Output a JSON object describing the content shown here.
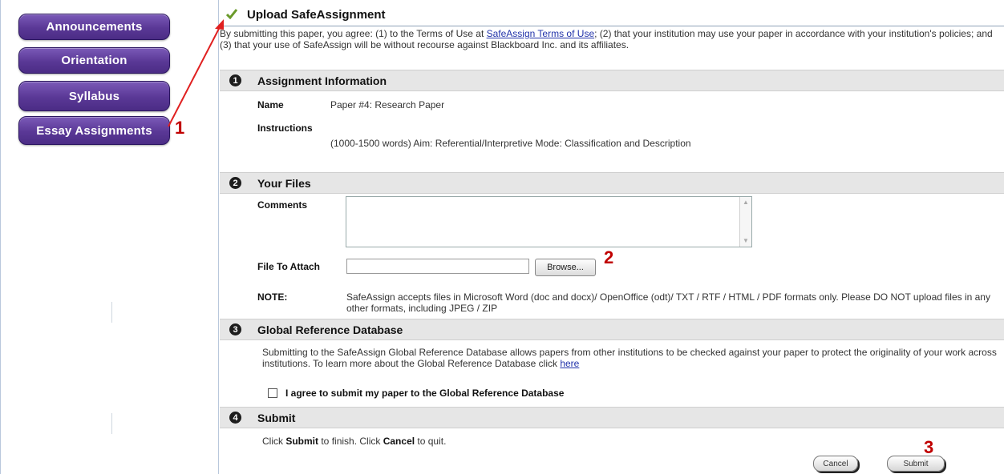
{
  "sidebar": {
    "items": [
      {
        "label": "Announcements"
      },
      {
        "label": "Orientation"
      },
      {
        "label": "Syllabus"
      },
      {
        "label": "Essay Assignments"
      }
    ]
  },
  "header": {
    "title": "Upload SafeAssignment"
  },
  "intro": {
    "text_before_link": "By submitting this paper, you agree: (1) to the Terms of Use at ",
    "link_text": "SafeAssign Terms of Use",
    "text_after_link": "; (2) that your institution may use your paper in accordance with your institution's policies; and (3) that your use of SafeAssign will be without recourse against Blackboard Inc. and its affiliates."
  },
  "sections": {
    "assignment": {
      "number": "1",
      "title": "Assignment Information",
      "name_label": "Name",
      "name_value": "Paper #4: Research Paper",
      "instructions_label": "Instructions",
      "instructions_value": "(1000-1500 words) Aim: Referential/Interpretive Mode: Classification and Description"
    },
    "files": {
      "number": "2",
      "title": "Your Files",
      "comments_label": "Comments",
      "attach_label": "File To Attach",
      "browse_label": "Browse...",
      "note_label": "NOTE:",
      "note_text": "SafeAssign accepts files in Microsoft Word (doc and docx)/ OpenOffice (odt)/ TXT / RTF / HTML / PDF formats only. Please DO NOT upload files in any other formats, including JPEG / ZIP"
    },
    "global": {
      "number": "3",
      "title": "Global Reference Database",
      "text_before_link": "Submitting to the SafeAssign Global Reference Database allows papers from other institutions to be checked against your paper to protect the originality of your work across institutions. To learn more about the Global Reference Database click ",
      "link_text": "here",
      "checkbox_label": "I agree to submit my paper to the Global Reference Database"
    },
    "submit": {
      "number": "4",
      "title": "Submit",
      "text_1": "Click ",
      "submit_word": "Submit",
      "text_2": " to finish. Click ",
      "cancel_word": "Cancel",
      "text_3": " to quit.",
      "cancel_button": "Cancel",
      "submit_button": "Submit"
    }
  },
  "annotations": {
    "step1": "1",
    "step2": "2",
    "step3": "3"
  },
  "colors": {
    "nav_purple": "#5a3896",
    "annotation_red": "#c00000",
    "section_bar": "#e6e6e6"
  }
}
